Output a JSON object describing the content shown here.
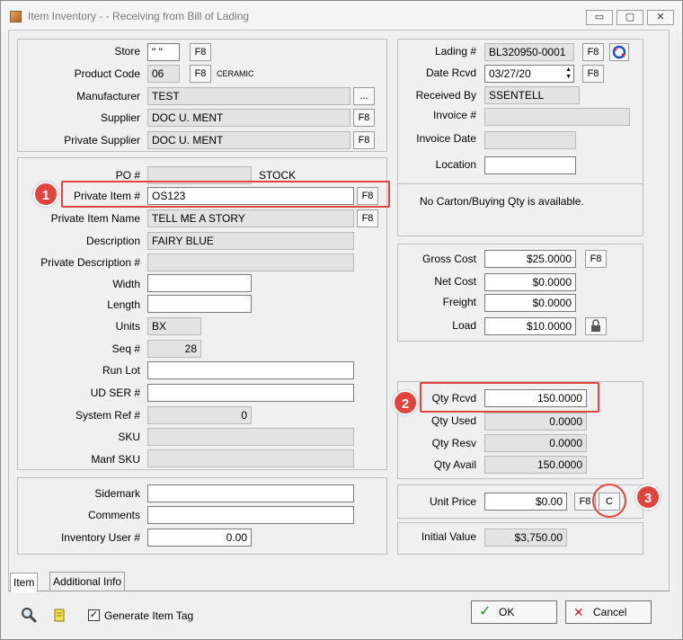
{
  "window": {
    "title": "Item Inventory - - Receiving from Bill of Lading",
    "minimize": "▭",
    "maximize": "▢",
    "close": "✕"
  },
  "f8": "F8",
  "left_top": {
    "store_label": "Store",
    "store_value": "\" \"",
    "product_code_label": "Product Code",
    "product_code_value": "06",
    "product_code_desc": "CERAMIC",
    "manufacturer_label": "Manufacturer",
    "manufacturer_value": "TEST",
    "manufacturer_btn": "...",
    "supplier_label": "Supplier",
    "supplier_value": "DOC U. MENT",
    "private_supplier_label": "Private Supplier",
    "private_supplier_value": "DOC U. MENT"
  },
  "item": {
    "po_label": "PO #",
    "po_value": "",
    "po_note": "STOCK",
    "private_item_label": "Private Item #",
    "private_item_value": "OS123",
    "private_item_name_label": "Private Item Name",
    "private_item_name_value": "TELL ME A STORY",
    "description_label": "Description",
    "description_value": "FAIRY BLUE",
    "private_description_label": "Private Description #",
    "private_description_value": "",
    "width_label": "Width",
    "width_value": "",
    "length_label": "Length",
    "length_value": "",
    "units_label": "Units",
    "units_value": "BX",
    "seq_label": "Seq #",
    "seq_value": "28",
    "run_lot_label": "Run Lot",
    "run_lot_value": "",
    "ud_ser_label": "UD SER #",
    "ud_ser_value": "",
    "system_ref_label": "System Ref #",
    "system_ref_value": "0",
    "sku_label": "SKU",
    "sku_value": "",
    "manf_sku_label": "Manf SKU",
    "manf_sku_value": ""
  },
  "extra": {
    "sidemark_label": "Sidemark",
    "sidemark_value": "",
    "comments_label": "Comments",
    "comments_value": "",
    "inventory_user_label": "Inventory User #",
    "inventory_user_value": "0.00"
  },
  "lading": {
    "lading_label": "Lading #",
    "lading_value": "BL320950-0001",
    "date_rcvd_label": "Date Rcvd",
    "date_rcvd_value": "03/27/20",
    "received_by_label": "Received By",
    "received_by_value": "SSENTELL",
    "invoice_label": "Invoice #",
    "invoice_value": "",
    "invoice_date_label": "Invoice Date",
    "invoice_date_value": "",
    "location_label": "Location",
    "location_value": ""
  },
  "carton_msg": "No Carton/Buying Qty is available.",
  "cost": {
    "gross_label": "Gross Cost",
    "gross_value": "$25.0000",
    "net_label": "Net Cost",
    "net_value": "$0.0000",
    "freight_label": "Freight",
    "freight_value": "$0.0000",
    "load_label": "Load",
    "load_value": "$10.0000"
  },
  "qty": {
    "rcvd_label": "Qty Rcvd",
    "rcvd_value": "150.0000",
    "used_label": "Qty Used",
    "used_value": "0.0000",
    "resv_label": "Qty Resv",
    "resv_value": "0.0000",
    "avail_label": "Qty Avail",
    "avail_value": "150.0000"
  },
  "price": {
    "unit_label": "Unit Price",
    "unit_value": "$0.00",
    "c_btn": "C"
  },
  "initial": {
    "label": "Initial Value",
    "value": "$3,750.00"
  },
  "badges": [
    "1",
    "2",
    "3"
  ],
  "tabs": [
    "Item",
    "Additional Info"
  ],
  "bottom": {
    "generate_tag_label": "Generate Item Tag",
    "generate_tag_checked": "✓",
    "ok": "OK",
    "cancel": "Cancel"
  },
  "icons": {
    "refresh": "refresh-icon",
    "lock": "lock-icon",
    "search": "magnifier-icon",
    "note": "note-icon"
  },
  "colors": {
    "highlight": "#e0443c",
    "ok_check": "#2a8a2a",
    "cancel_x": "#c02020"
  }
}
